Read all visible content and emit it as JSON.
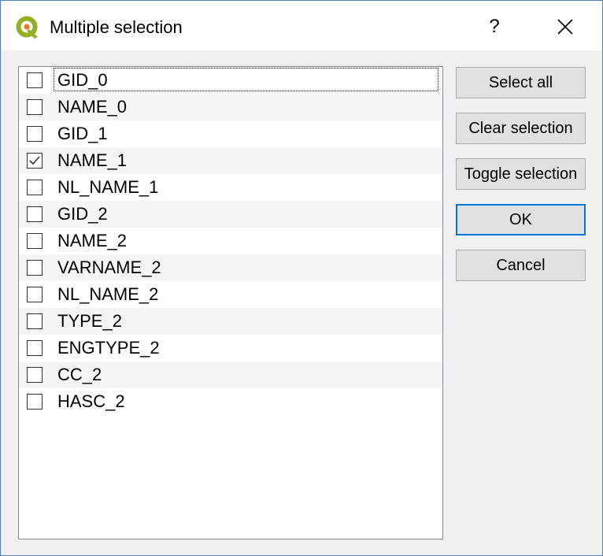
{
  "window": {
    "title": "Multiple selection",
    "help_label": "?",
    "accent_color": "#0078d7"
  },
  "list": {
    "items": [
      {
        "label": "GID_0",
        "checked": false
      },
      {
        "label": "NAME_0",
        "checked": false
      },
      {
        "label": "GID_1",
        "checked": false
      },
      {
        "label": "NAME_1",
        "checked": true
      },
      {
        "label": "NL_NAME_1",
        "checked": false
      },
      {
        "label": "GID_2",
        "checked": false
      },
      {
        "label": "NAME_2",
        "checked": false
      },
      {
        "label": "VARNAME_2",
        "checked": false
      },
      {
        "label": "NL_NAME_2",
        "checked": false
      },
      {
        "label": "TYPE_2",
        "checked": false
      },
      {
        "label": "ENGTYPE_2",
        "checked": false
      },
      {
        "label": "CC_2",
        "checked": false
      },
      {
        "label": "HASC_2",
        "checked": false
      }
    ]
  },
  "buttons": {
    "select_all": "Select all",
    "clear_selection": "Clear selection",
    "toggle_selection": "Toggle selection",
    "ok": "OK",
    "cancel": "Cancel"
  },
  "icons": {
    "app": "qgis-logo-icon",
    "close": "close-icon",
    "check": "checkmark-icon"
  }
}
